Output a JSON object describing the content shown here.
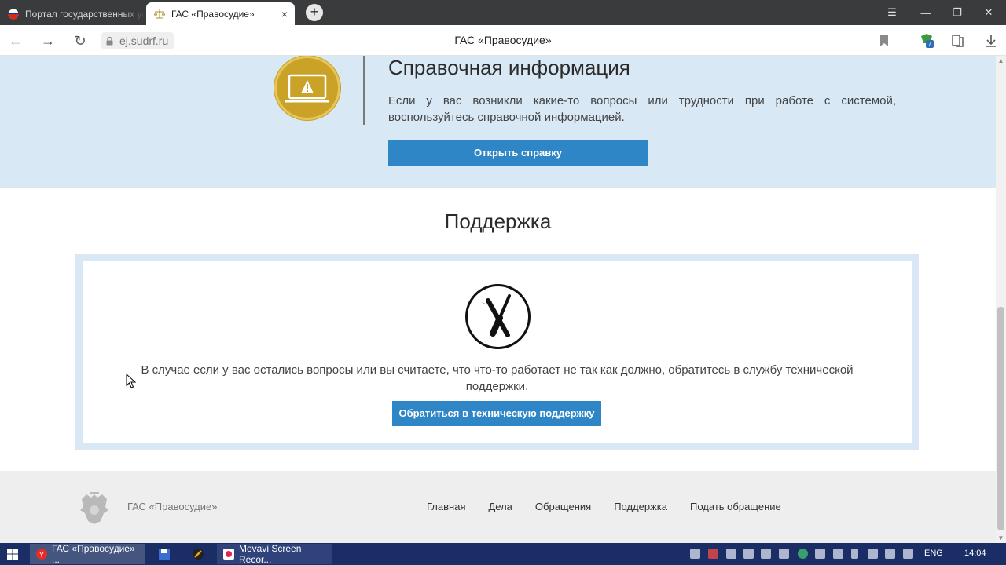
{
  "browser": {
    "tabs": [
      {
        "title": "Портал государственных услуг Российской Федерации"
      },
      {
        "title": "ГАС «Правосудие»",
        "close": "×"
      }
    ],
    "new_tab": "+",
    "window_controls": [
      "☰",
      "—",
      "❐",
      "✕"
    ],
    "url": "ej.sudrf.ru",
    "page_title": "ГАС «Правосудие»",
    "nav": {
      "back": "←",
      "forward": "→",
      "reload": "↻"
    },
    "extension_badge": "7"
  },
  "info_section": {
    "title": "Справочная информация",
    "text": "Если у вас возникли какие-то вопросы или трудности при работе с системой, воспользуйтесь справочной информацией.",
    "button": "Открыть справку",
    "badge_color": "#c9a227"
  },
  "support_section": {
    "heading": "Поддержка",
    "text": "В случае если у вас остались вопросы или вы считаете, что что-то работает не так как должно, обратитесь в службу технической поддержки.",
    "button": "Обратиться в техническую поддержку"
  },
  "footer": {
    "brand": "ГАС «Правосудие»",
    "nav": [
      "Главная",
      "Дела",
      "Обращения",
      "Поддержка",
      "Подать обращение"
    ]
  },
  "taskbar": {
    "apps": [
      {
        "label": "ГАС «Правосудие» ..."
      },
      {
        "label": "Movavi Screen Recor..."
      }
    ],
    "language": "ENG",
    "time": "14:04"
  },
  "colors": {
    "accent_blue": "#2e86c6",
    "band_light_blue": "#d9e8f5",
    "taskbar": "#1a2d64"
  }
}
